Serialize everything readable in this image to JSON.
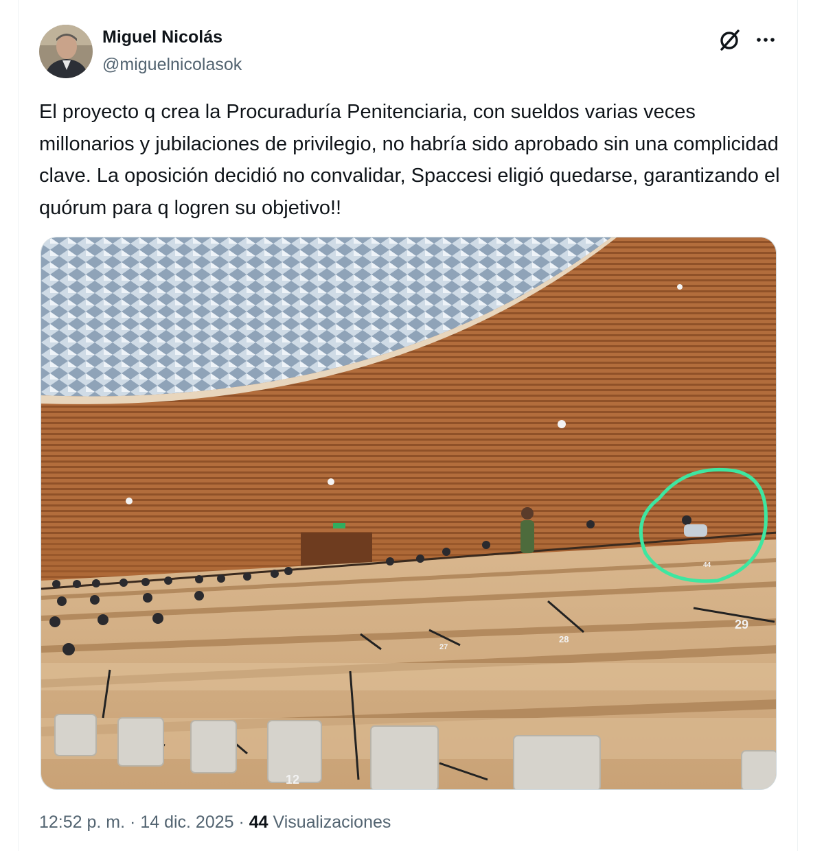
{
  "post": {
    "author_name": "Miguel Nicolás",
    "author_handle": "@miguelnicolasok",
    "text": "El proyecto q crea la Procuraduría Penitenciaria, con sueldos varias veces millonarios y jubilaciones de privilegio, no habría sido aprobado sin una complicidad clave. La oposición decidió no convalidar, Spaccesi eligió quedarse, garantizando el quórum para q logren su objetivo!!",
    "time": "12:52 p. m.",
    "separator": "·",
    "date": "14 dic. 2025",
    "views_count": "44",
    "views_label": "Visualizaciones"
  },
  "icons": {
    "grok": "grok-icon",
    "more": "more-icon"
  },
  "media": {
    "seat_numbers": [
      "29",
      "28",
      "27",
      "12",
      "44"
    ],
    "highlight_color": "#3ee6a0"
  }
}
